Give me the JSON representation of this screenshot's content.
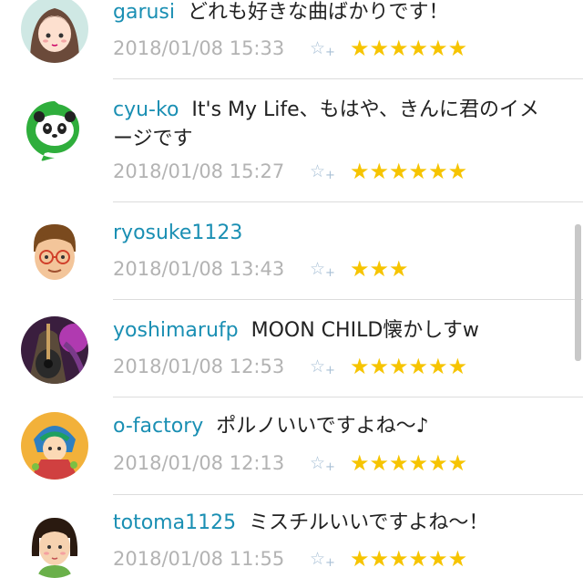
{
  "comments": [
    {
      "user": "garusi",
      "text": "どれも好きな曲ばかりです！",
      "date": "2018/01/08 15:33",
      "add_star_icon": "add-star-icon",
      "stars": "★★★★★★",
      "star_count": 6,
      "avatar": "anime-girl-avatar"
    },
    {
      "user": "cyu-ko",
      "text": "It's My Life、もはや、きんに君のイメージです",
      "date": "2018/01/08 15:27",
      "add_star_icon": "add-star-icon",
      "stars": "★★★★★★",
      "star_count": 6,
      "avatar": "panda-avatar"
    },
    {
      "user": "ryosuke1123",
      "text": "",
      "date": "2018/01/08 13:43",
      "add_star_icon": "add-star-icon",
      "stars": "★★★",
      "star_count": 3,
      "avatar": "glasses-man-avatar"
    },
    {
      "user": "yoshimarufp",
      "text": "MOON CHILD懐かしすw",
      "date": "2018/01/08 12:53",
      "add_star_icon": "add-star-icon",
      "stars": "★★★★★★",
      "star_count": 6,
      "avatar": "guitar-avatar"
    },
    {
      "user": "o-factory",
      "text": "ポルノいいですよね〜♪",
      "date": "2018/01/08 12:13",
      "add_star_icon": "add-star-icon",
      "stars": "★★★★★★",
      "star_count": 6,
      "avatar": "illustration-avatar"
    },
    {
      "user": "totoma1125",
      "text": "ミスチルいいですよね〜！",
      "date": "2018/01/08 11:55",
      "add_star_icon": "add-star-icon",
      "stars": "★★★★★★",
      "star_count": 6,
      "avatar": "bob-hair-girl-avatar"
    }
  ],
  "colors": {
    "username": "#1a8fb3",
    "star": "#f6c400",
    "date": "#b3b3b3",
    "add_star": "#a8c0d6"
  }
}
